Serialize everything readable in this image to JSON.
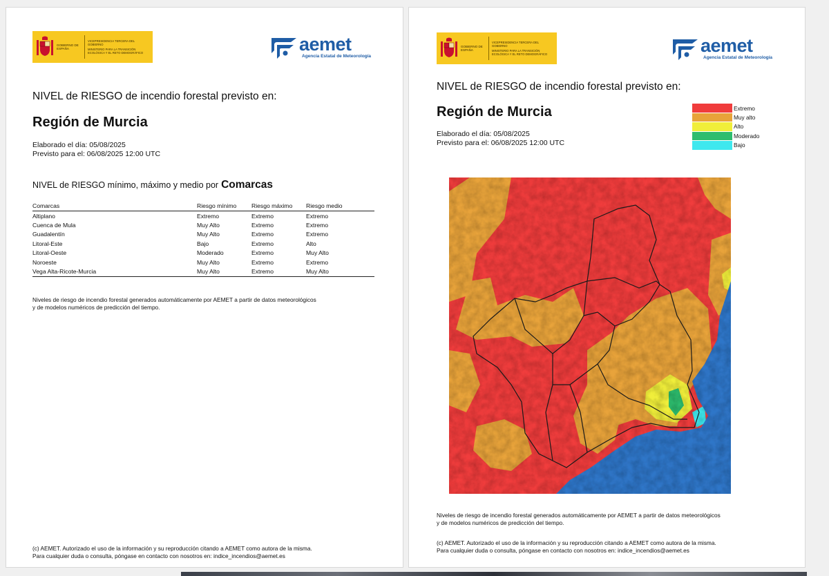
{
  "colors": {
    "extremo": "#f03c3c",
    "muy_alto": "#e8a33a",
    "alto": "#f0ee3a",
    "moderado": "#2ebd6e",
    "bajo": "#3ee8ee",
    "sea": "#2f76c8",
    "gov_yellow": "#f7c821",
    "aemet_blue": "#1f5da6"
  },
  "logos": {
    "gov_left": "Gobierno de España",
    "gov_right_1": "Vicepresidencia tercera del Gobierno",
    "gov_right_2": "Ministerio para la Transición Ecológica y el Reto Demográfico",
    "aemet_word": "aemet",
    "aemet_sub": "Agencia Estatal de Meteorología"
  },
  "left": {
    "heading": "NIVEL de RIESGO de incendio forestal previsto en:",
    "region": "Región de Murcia",
    "elaborado": "Elaborado el día: 05/08/2025",
    "previsto": "Previsto para el: 06/08/2025 12:00 UTC",
    "subheading": "NIVEL de RIESGO mínimo, máximo y medio por",
    "subheading_bold": "Comarcas",
    "table": {
      "headers": [
        "Comarcas",
        "Riesgo mínimo",
        "Riesgo máximo",
        "Riesgo medio"
      ],
      "rows": [
        [
          "Altiplano",
          "Extremo",
          "Extremo",
          "Extremo"
        ],
        [
          "Cuenca de Mula",
          "Muy Alto",
          "Extremo",
          "Extremo"
        ],
        [
          "Guadalentín",
          "Muy Alto",
          "Extremo",
          "Extremo"
        ],
        [
          "Litoral-Este",
          "Bajo",
          "Extremo",
          "Alto"
        ],
        [
          "Litoral-Oeste",
          "Moderado",
          "Extremo",
          "Muy Alto"
        ],
        [
          "Noroeste",
          "Muy Alto",
          "Extremo",
          "Extremo"
        ],
        [
          "Vega Alta-Ricote-Murcia",
          "Muy Alto",
          "Extremo",
          "Muy Alto"
        ]
      ]
    },
    "note_1": "Niveles de riesgo de incendio forestal generados automáticamente por AEMET a partir de datos meteorológicos",
    "note_2": "y de modelos numéricos de predicción del tiempo.",
    "footer_1": "(c) AEMET. Autorizado el uso de la información y su reproducción citando a AEMET como autora de la misma.",
    "footer_2": "Para cualquier duda o consulta, póngase en contacto con nosotros en: indice_incendios@aemet.es"
  },
  "right": {
    "heading": "NIVEL de RIESGO de incendio forestal previsto en:",
    "region": "Región de Murcia",
    "elaborado": "Elaborado el día: 05/08/2025",
    "previsto": "Previsto para el: 06/08/2025 12:00 UTC",
    "legend": [
      {
        "label": "Extremo",
        "color": "#f03c3c"
      },
      {
        "label": "Muy alto",
        "color": "#e8a33a"
      },
      {
        "label": "Alto",
        "color": "#f0ee3a"
      },
      {
        "label": "Moderado",
        "color": "#2ebd6e"
      },
      {
        "label": "Bajo",
        "color": "#3ee8ee"
      }
    ],
    "note_1": "Niveles de riesgo de incendio forestal generados automáticamente por AEMET a partir de datos meteorológicos",
    "note_2": "y de modelos numéricos de predicción del tiempo.",
    "footer_1": "(c) AEMET. Autorizado el uso de la información y su reproducción citando a AEMET como autora de la misma.",
    "footer_2": "Para cualquier duda o consulta, póngase en contacto con nosotros en: indice_incendios@aemet.es"
  }
}
